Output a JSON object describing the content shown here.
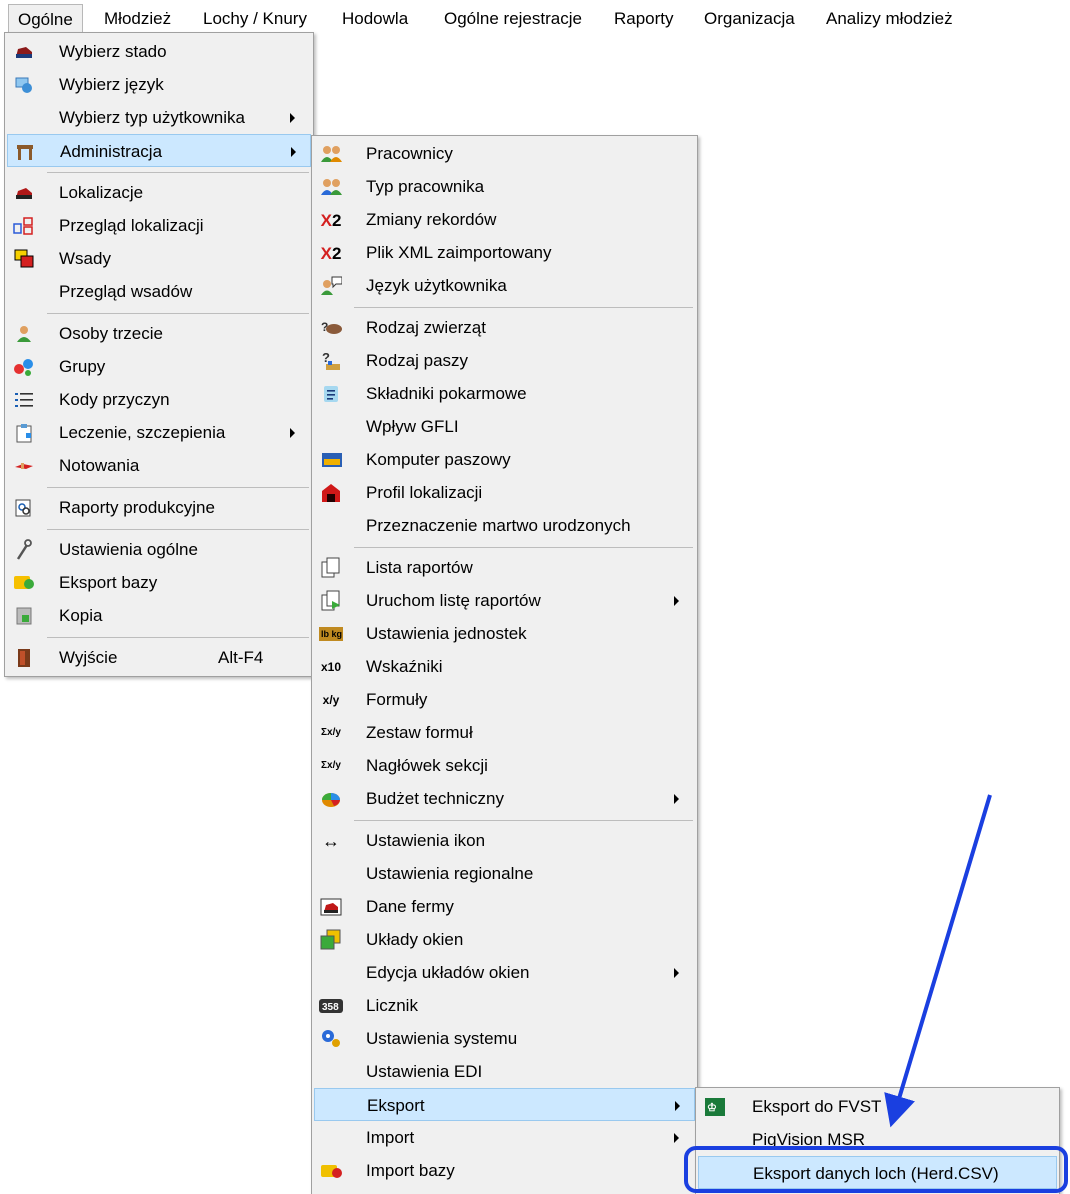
{
  "menubar": {
    "items": [
      {
        "label": "Ogólne"
      },
      {
        "label": "Młodzież"
      },
      {
        "label": "Lochy / Knury"
      },
      {
        "label": "Hodowla"
      },
      {
        "label": "Ogólne rejestracje"
      },
      {
        "label": "Raporty"
      },
      {
        "label": "Organizacja"
      },
      {
        "label": "Analizy młodzież"
      }
    ]
  },
  "menu1": {
    "items": [
      {
        "label": "Wybierz stado",
        "icon": "herd-icon"
      },
      {
        "label": "Wybierz język",
        "icon": "language-icon"
      },
      {
        "label": "Wybierz typ użytkownika",
        "icon": "",
        "submenu": true
      },
      {
        "label": "Administracja",
        "icon": "administration-icon",
        "submenu": true
      },
      {
        "label": "Lokalizacje",
        "icon": "barn-icon"
      },
      {
        "label": "Przegląd lokalizacji",
        "icon": "grid-icon"
      },
      {
        "label": "Wsady",
        "icon": "batch-icon"
      },
      {
        "label": "Przegląd wsadów",
        "icon": ""
      },
      {
        "label": "Osoby trzecie",
        "icon": "person-icon"
      },
      {
        "label": "Grupy",
        "icon": "groups-icon"
      },
      {
        "label": "Kody przyczyn",
        "icon": "list-icon"
      },
      {
        "label": "Leczenie, szczepienia",
        "icon": "clipboard-icon",
        "submenu": true
      },
      {
        "label": "Notowania",
        "icon": "quotes-icon"
      },
      {
        "label": "Raporty produkcyjne",
        "icon": "report-icon"
      },
      {
        "label": "Ustawienia ogólne",
        "icon": "wrench-icon"
      },
      {
        "label": "Eksport bazy",
        "icon": "export-db-icon"
      },
      {
        "label": "Kopia",
        "icon": "backup-icon"
      },
      {
        "label": "Wyjście",
        "icon": "exit-icon",
        "shortcut": "Alt-F4"
      }
    ]
  },
  "menu2": {
    "items": [
      {
        "label": "Pracownicy",
        "icon": "employees-icon"
      },
      {
        "label": "Typ pracownika",
        "icon": "employee-type-icon"
      },
      {
        "label": "Zmiany rekordów",
        "icon": "x2-icon",
        "glyph": "X2"
      },
      {
        "label": "Plik XML zaimportowany",
        "icon": "x2-icon",
        "glyph": "X2"
      },
      {
        "label": "Język użytkownika",
        "icon": "user-language-icon"
      },
      {
        "label": "Rodzaj zwierząt",
        "icon": "animal-type-icon"
      },
      {
        "label": "Rodzaj paszy",
        "icon": "feed-type-icon"
      },
      {
        "label": "Składniki pokarmowe",
        "icon": "nutrients-icon"
      },
      {
        "label": "Wpływ GFLI",
        "icon": ""
      },
      {
        "label": "Komputer paszowy",
        "icon": "feed-computer-icon"
      },
      {
        "label": "Profil lokalizacji",
        "icon": "location-profile-icon"
      },
      {
        "label": "Przeznaczenie martwo urodzonych",
        "icon": ""
      },
      {
        "label": "Lista raportów",
        "icon": "report-list-icon"
      },
      {
        "label": "Uruchom listę raportów",
        "icon": "run-reports-icon",
        "submenu": true
      },
      {
        "label": "Ustawienia jednostek",
        "icon": "units-icon",
        "glyph": "lb kg"
      },
      {
        "label": "Wskaźniki",
        "icon": "indicators-icon",
        "glyph": "x10"
      },
      {
        "label": "Formuły",
        "icon": "formulas-icon",
        "glyph": "x/y"
      },
      {
        "label": "Zestaw formuł",
        "icon": "formula-set-icon",
        "glyph": "Σx/y"
      },
      {
        "label": "Nagłówek sekcji",
        "icon": "section-header-icon",
        "glyph": "Σx/y"
      },
      {
        "label": "Budżet techniczny",
        "icon": "budget-icon",
        "submenu": true
      },
      {
        "label": "Ustawienia ikon",
        "icon": "icon-settings-icon",
        "glyph": "↔"
      },
      {
        "label": "Ustawienia regionalne",
        "icon": ""
      },
      {
        "label": "Dane fermy",
        "icon": "farm-data-icon"
      },
      {
        "label": "Układy okien",
        "icon": "window-layout-icon"
      },
      {
        "label": "Edycja układów okien",
        "icon": "",
        "submenu": true
      },
      {
        "label": "Licznik",
        "icon": "counter-icon",
        "glyph": "358"
      },
      {
        "label": "Ustawienia systemu",
        "icon": "system-settings-icon"
      },
      {
        "label": "Ustawienia EDI",
        "icon": ""
      },
      {
        "label": "Eksport",
        "icon": "",
        "submenu": true
      },
      {
        "label": "Import",
        "icon": "",
        "submenu": true
      },
      {
        "label": "Import bazy",
        "icon": "import-db-icon"
      }
    ]
  },
  "menu3": {
    "items": [
      {
        "label": "Eksport do FVST",
        "icon": "fvst-icon"
      },
      {
        "label": "PigVision MSR",
        "icon": ""
      },
      {
        "label": "Eksport danych loch (Herd.CSV)",
        "icon": ""
      }
    ]
  },
  "colors": {
    "menu_bg": "#f0f0f0",
    "highlight_bg": "#cce8ff",
    "highlight_border": "#99c9ef",
    "annotation": "#1a3fe0"
  }
}
